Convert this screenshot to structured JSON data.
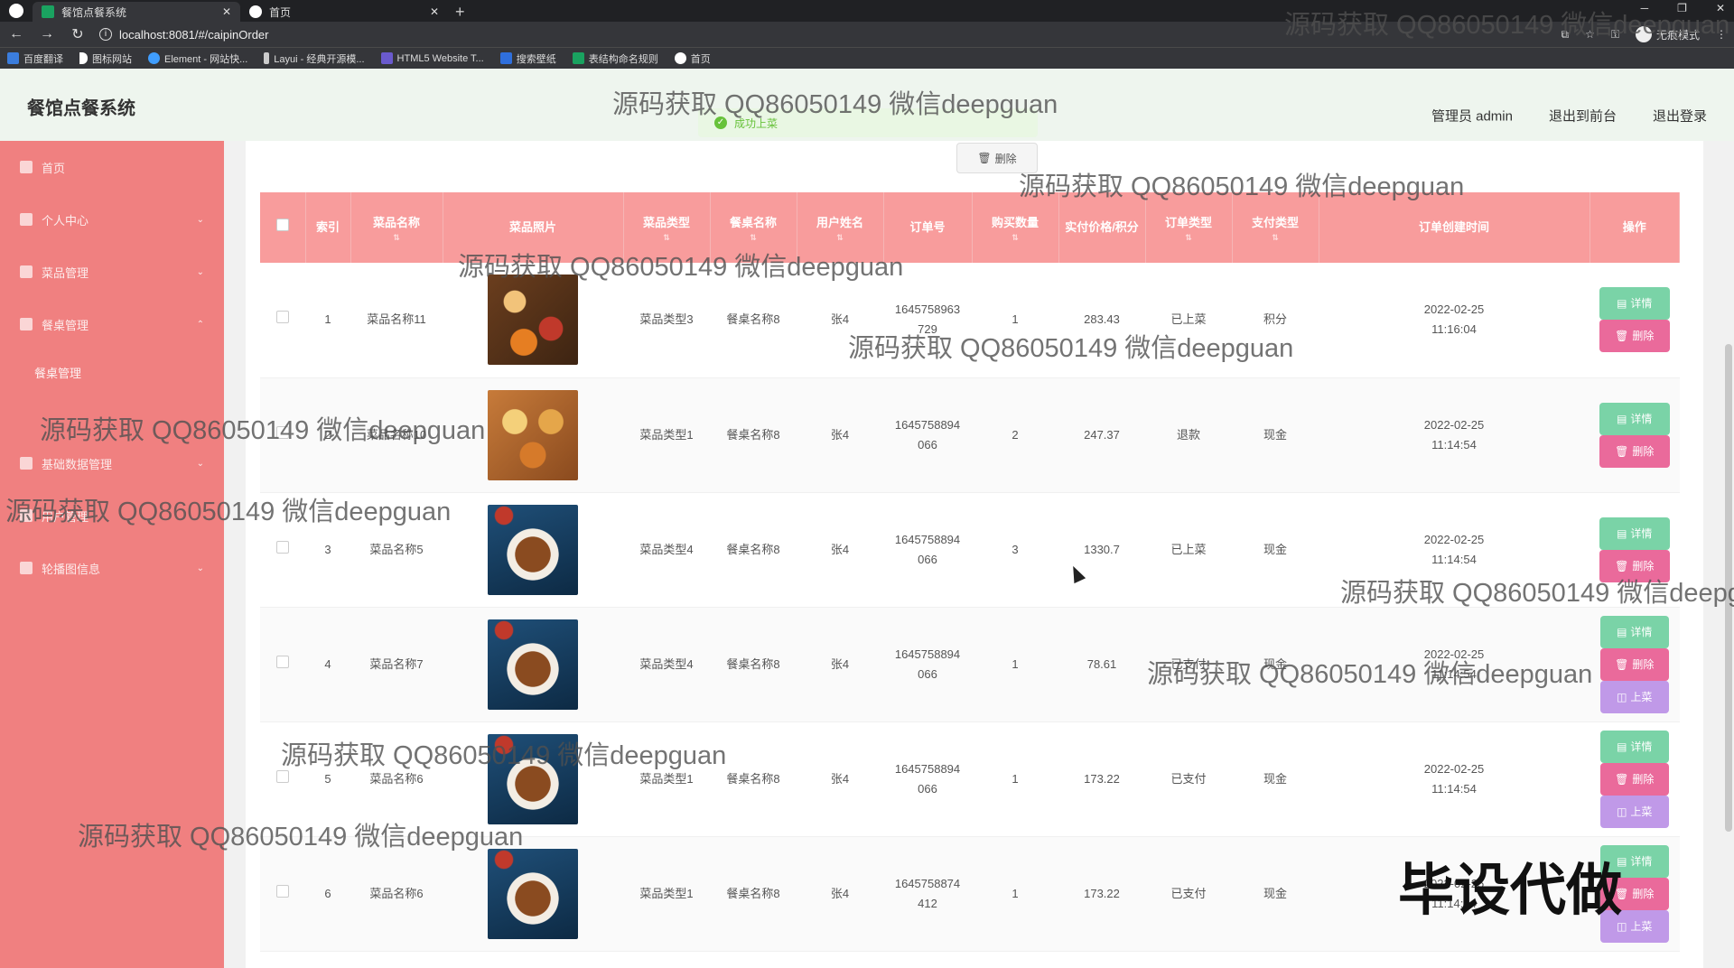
{
  "browser": {
    "tabs": [
      {
        "title": "餐馆点餐系统",
        "active": true
      },
      {
        "title": "首页",
        "active": false
      }
    ],
    "url": "localhost:8081/#/caipinOrder",
    "profile": "无痕模式",
    "bookmarks": [
      "百度翻译",
      "图标网站",
      "Element - 网站快...",
      "Layui - 经典开源模...",
      "HTML5 Website T...",
      "搜索壁纸",
      "表结构命名规则",
      "首页"
    ]
  },
  "app": {
    "title": "餐馆点餐系统",
    "toast": "成功上菜",
    "header_links": [
      "管理员 admin",
      "退出到前台",
      "退出登录"
    ]
  },
  "sidebar": {
    "items": [
      {
        "label": "首页",
        "icon": "home-icon"
      },
      {
        "label": "个人中心",
        "icon": "user-icon"
      },
      {
        "label": "菜品管理",
        "icon": "list-icon"
      },
      {
        "label": "餐桌管理",
        "icon": "menu-icon"
      }
    ],
    "sub_items": [
      "餐桌管理"
    ],
    "items_after": [
      {
        "label": "基础数据管理",
        "icon": "database-icon"
      },
      {
        "label": "用户管理",
        "icon": "users-icon"
      },
      {
        "label": "轮播图信息",
        "icon": "grid-icon"
      }
    ]
  },
  "toolbar": {
    "delete_label": "删除"
  },
  "table": {
    "headers": [
      "索引",
      "菜品名称",
      "菜品照片",
      "菜品类型",
      "餐桌名称",
      "用户姓名",
      "订单号",
      "购买数量",
      "实付价格/积分",
      "订单类型",
      "支付类型",
      "订单创建时间",
      "操作"
    ],
    "rows": [
      {
        "index": "1",
        "name": "菜品名称11",
        "img": "food-a",
        "type": "菜品类型3",
        "table": "餐桌名称8",
        "user": "张4",
        "order": "1645758963729",
        "qty": "1",
        "price": "283.43",
        "otype": "已上菜",
        "pay": "积分",
        "time": "2022-02-25 11:16:04",
        "actions": [
          "详情",
          "删除"
        ]
      },
      {
        "index": "2",
        "name": "菜品名称10",
        "img": "food-b",
        "type": "菜品类型1",
        "table": "餐桌名称8",
        "user": "张4",
        "order": "1645758894066",
        "qty": "2",
        "price": "247.37",
        "otype": "退款",
        "pay": "现金",
        "time": "2022-02-25 11:14:54",
        "actions": [
          "详情",
          "删除"
        ]
      },
      {
        "index": "3",
        "name": "菜品名称5",
        "img": "food-c",
        "type": "菜品类型4",
        "table": "餐桌名称8",
        "user": "张4",
        "order": "1645758894066",
        "qty": "3",
        "price": "1330.7",
        "otype": "已上菜",
        "pay": "现金",
        "time": "2022-02-25 11:14:54",
        "actions": [
          "详情",
          "删除"
        ]
      },
      {
        "index": "4",
        "name": "菜品名称7",
        "img": "food-c",
        "type": "菜品类型4",
        "table": "餐桌名称8",
        "user": "张4",
        "order": "1645758894066",
        "qty": "1",
        "price": "78.61",
        "otype": "已支付",
        "pay": "现金",
        "time": "2022-02-25 11:14:54",
        "actions": [
          "详情",
          "删除",
          "上菜"
        ]
      },
      {
        "index": "5",
        "name": "菜品名称6",
        "img": "food-c",
        "type": "菜品类型1",
        "table": "餐桌名称8",
        "user": "张4",
        "order": "1645758894066",
        "qty": "1",
        "price": "173.22",
        "otype": "已支付",
        "pay": "现金",
        "time": "2022-02-25 11:14:54",
        "actions": [
          "详情",
          "删除",
          "上菜"
        ]
      },
      {
        "index": "6",
        "name": "菜品名称6",
        "img": "food-c",
        "type": "菜品类型1",
        "table": "餐桌名称8",
        "user": "张4",
        "order": "1645758874412",
        "qty": "1",
        "price": "173.22",
        "otype": "已支付",
        "pay": "现金",
        "time": "2022-02-25 11:14:34",
        "actions": [
          "详情",
          "删除",
          "上菜"
        ]
      }
    ]
  },
  "watermarks": {
    "text": "源码获取 QQ86050149 微信deepguan",
    "stamp": "毕设代做"
  },
  "colors": {
    "sidebar": "#f08080",
    "table_header": "#f89c9c",
    "detail_btn": "#7ad3a7",
    "delete_btn": "#ea6a9b",
    "serve_btn": "#c099e8",
    "success": "#67c23a"
  }
}
